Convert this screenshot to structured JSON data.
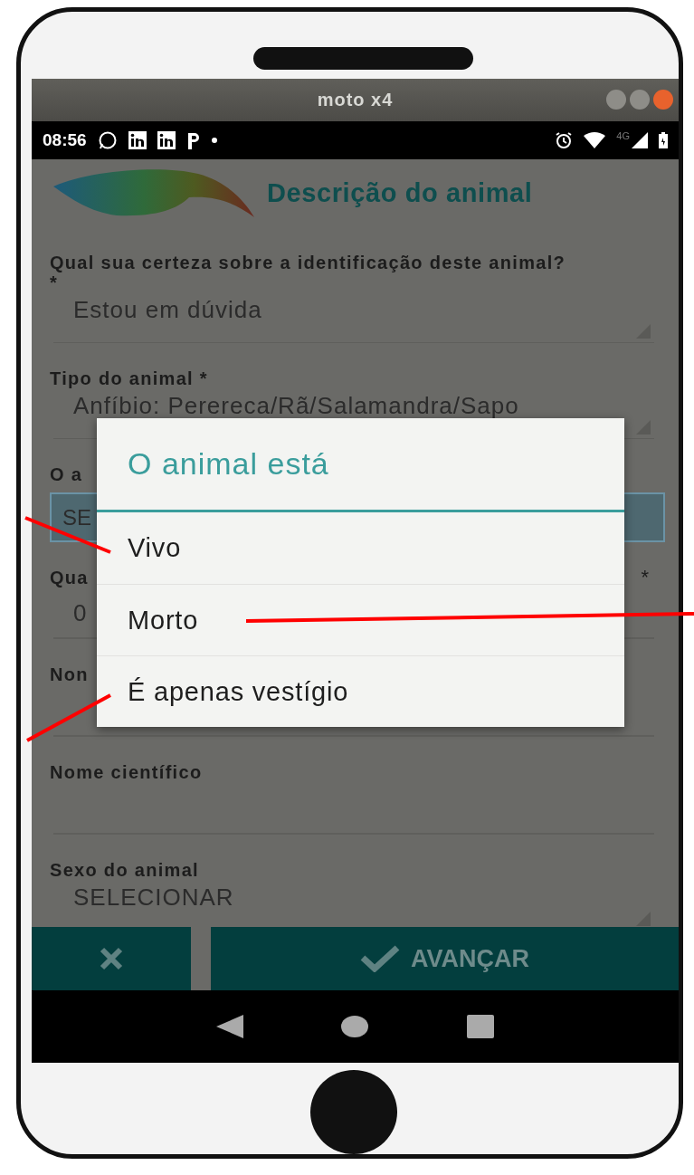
{
  "window": {
    "title": "moto x4"
  },
  "status_bar": {
    "time": "08:56",
    "network": "4G"
  },
  "header": {
    "title": "Descrição do animal"
  },
  "fields": [
    {
      "kind": "select",
      "label": "Qual sua certeza sobre a identificação deste animal? *",
      "value": "Estou em dúvida",
      "focused": false
    },
    {
      "kind": "select",
      "label": "Tipo do animal *",
      "value": "Anfíbio: Perereca/Rã/Salamandra/Sapo",
      "focused": false
    },
    {
      "kind": "select",
      "label": "O a",
      "value": "SE",
      "focused": true
    },
    {
      "kind": "input",
      "label": "Qua",
      "mark": "*",
      "value": "0"
    },
    {
      "kind": "input",
      "label": "Non"
    },
    {
      "kind": "input",
      "label": "Nome científico"
    },
    {
      "kind": "select",
      "label": "Sexo do animal",
      "value": "SELECIONAR",
      "focused": false
    }
  ],
  "actions": {
    "next": "AVANÇAR"
  },
  "dialog": {
    "title": "O animal está",
    "options": [
      {
        "label": "Vivo"
      },
      {
        "label": "Morto"
      },
      {
        "label": "É apenas vestígio"
      }
    ]
  }
}
